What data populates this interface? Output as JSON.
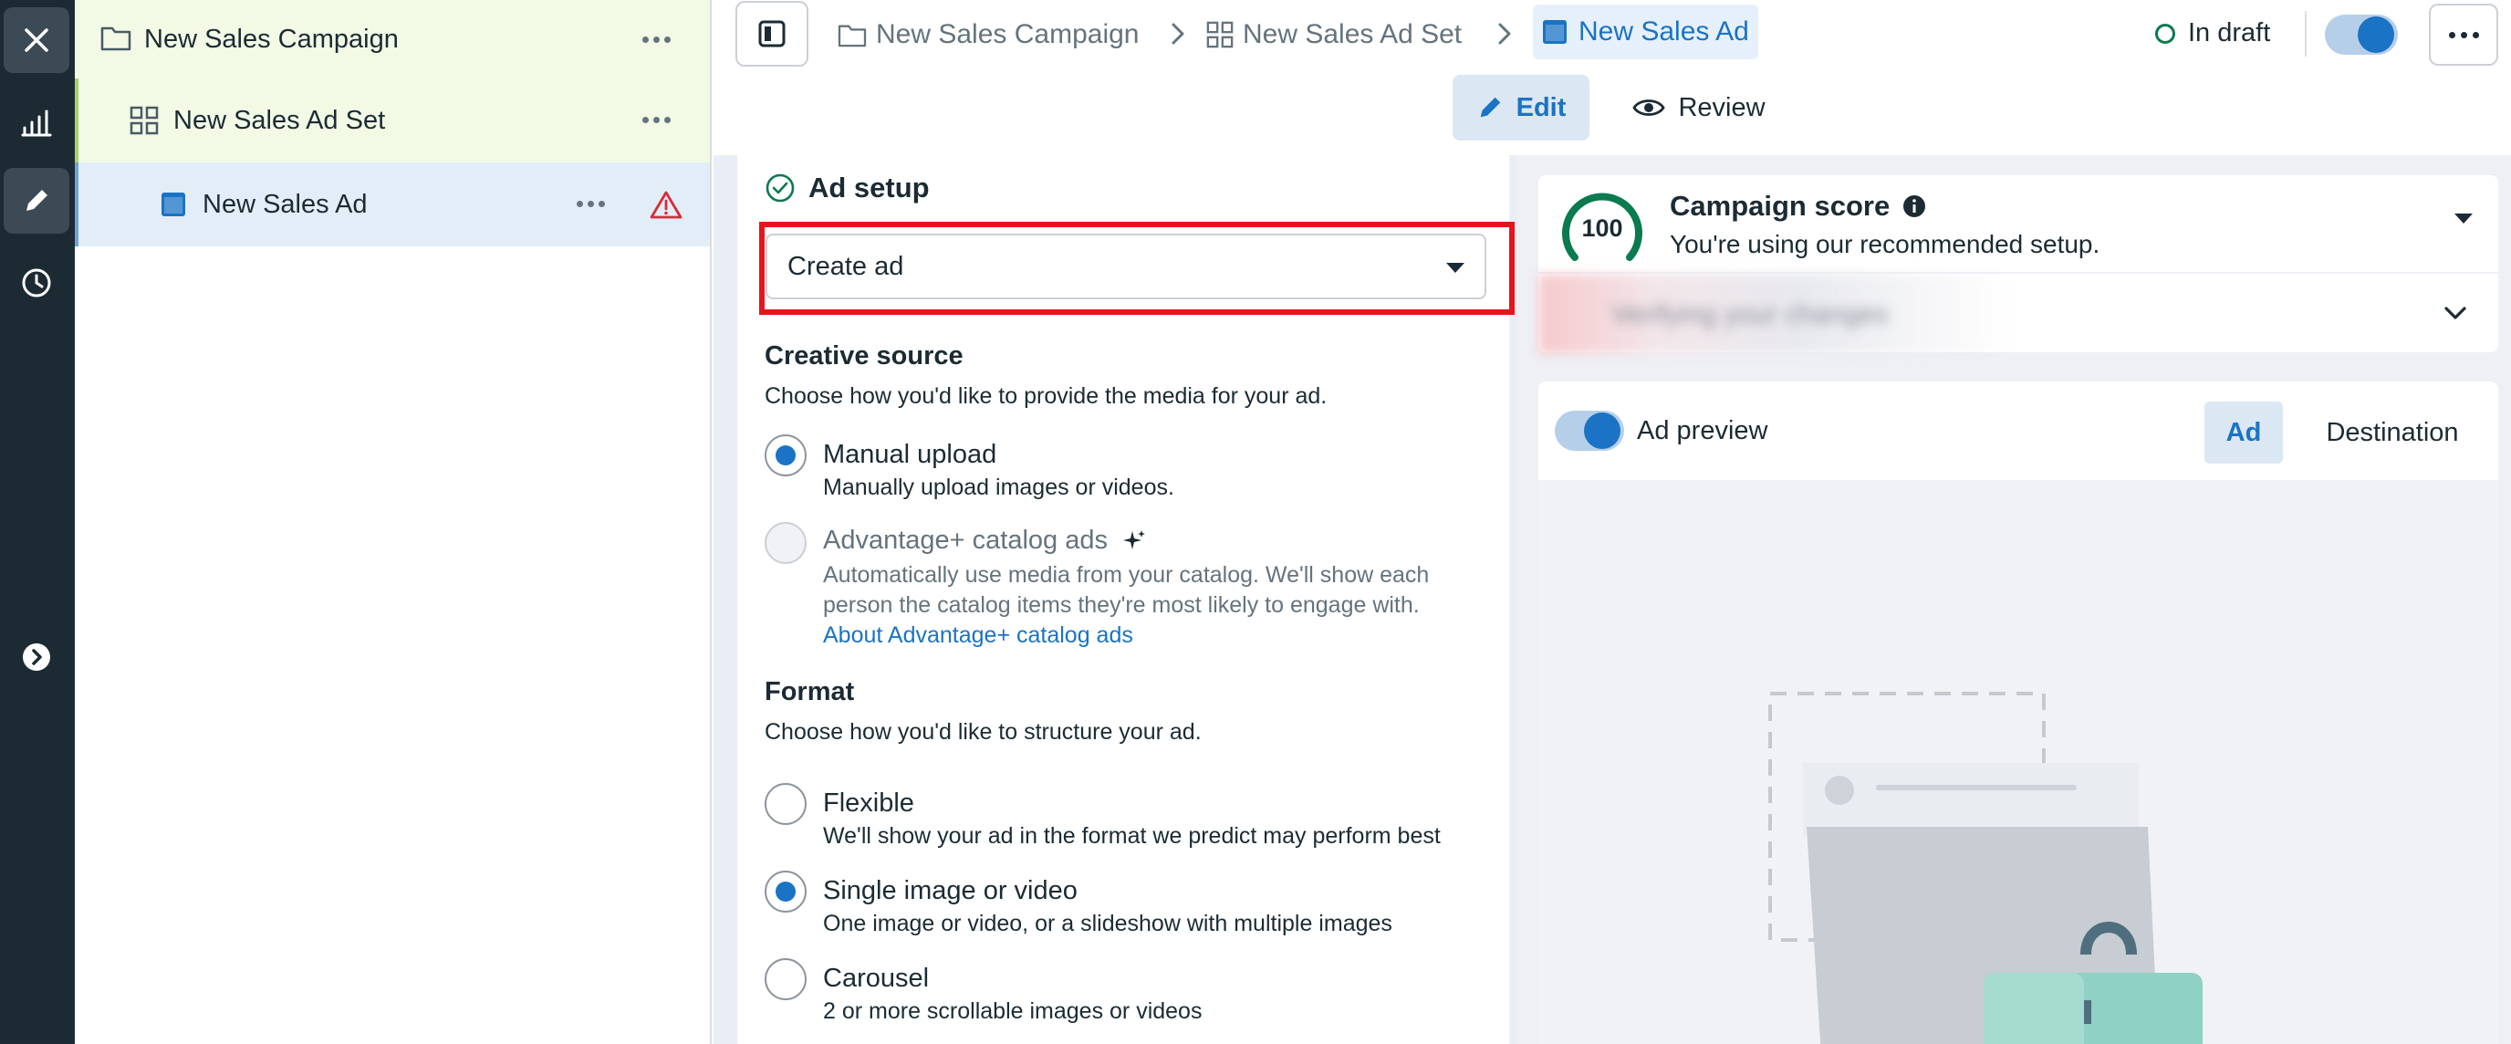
{
  "tree": {
    "campaign": "New Sales Campaign",
    "adset": "New Sales Ad Set",
    "ad": "New Sales Ad"
  },
  "breadcrumb": {
    "campaign": "New Sales Campaign",
    "adset": "New Sales Ad Set",
    "ad": "New Sales Ad"
  },
  "header": {
    "status": "In draft",
    "status_color": "#0a7a4f"
  },
  "tabs": {
    "edit": "Edit",
    "review": "Review"
  },
  "ad_setup": {
    "title": "Ad setup",
    "select_value": "Create ad",
    "creative_source": {
      "title": "Creative source",
      "description": "Choose how you'd like to provide the media for your ad.",
      "options": [
        {
          "label": "Manual upload",
          "description": "Manually upload images or videos.",
          "selected": true
        },
        {
          "label": "Advantage+ catalog ads",
          "description": "Automatically use media from your catalog. We'll show each person the catalog items they're most likely to engage with.",
          "link": "About Advantage+ catalog ads",
          "disabled": true
        }
      ]
    },
    "format": {
      "title": "Format",
      "description": "Choose how you'd like to structure your ad.",
      "options": [
        {
          "label": "Flexible",
          "description": "We'll show your ad in the format we predict may perform best",
          "selected": false
        },
        {
          "label": "Single image or video",
          "description": "One image or video, or a slideshow with multiple images",
          "selected": true
        },
        {
          "label": "Carousel",
          "description": "2 or more scrollable images or videos",
          "selected": false
        }
      ]
    }
  },
  "campaign_score": {
    "score": "100",
    "title": "Campaign score",
    "subtitle": "You're using our recommended setup."
  },
  "blurred_row": "Verifying your changes",
  "preview": {
    "label": "Ad preview",
    "tab_ad": "Ad",
    "tab_destination": "Destination"
  },
  "colors": {
    "accent": "#1a73c5",
    "highlight": "#e8141c",
    "warning": "#d62d3a",
    "rail": "#1c2b33"
  }
}
